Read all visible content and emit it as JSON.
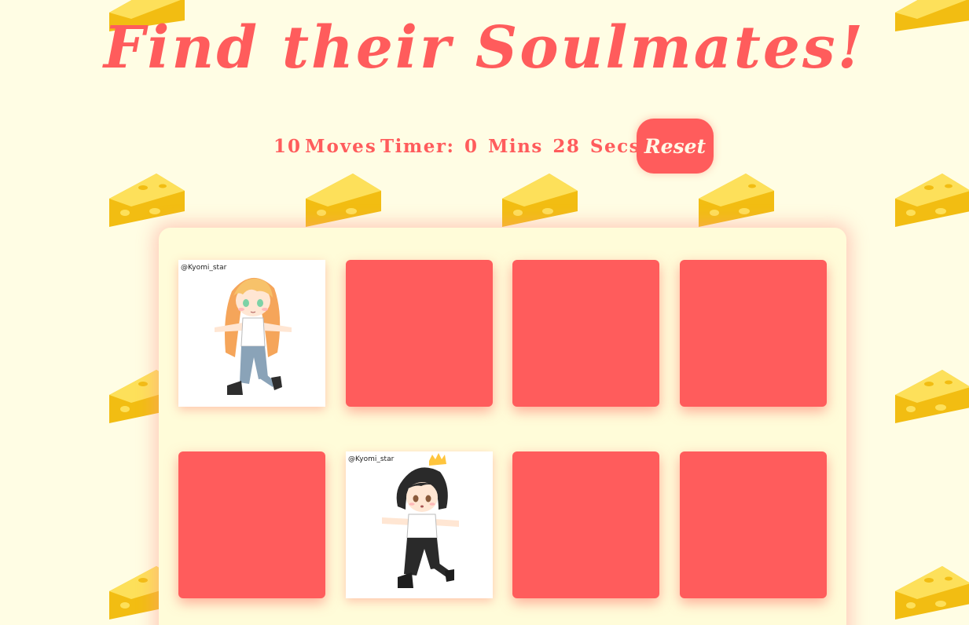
{
  "title": "Find their Soulmates!",
  "score_panel": {
    "moves_count": "10",
    "moves_label": "Moves",
    "timer_text": "Timer: 0 Mins 28 Secs",
    "reset_label": "Reset"
  },
  "colors": {
    "accent": "#ff5c5c",
    "background": "#fffde4",
    "deck": "#fffcd9",
    "cheese": "#f7c818"
  },
  "deck": {
    "cards": [
      {
        "state": "open",
        "character": "blonde-girl",
        "watermark": "@Kyomi_star"
      },
      {
        "state": "closed"
      },
      {
        "state": "closed"
      },
      {
        "state": "closed"
      },
      {
        "state": "closed"
      },
      {
        "state": "open",
        "character": "dark-haired-boy-crown",
        "watermark": "@Kyomi_star"
      },
      {
        "state": "closed"
      },
      {
        "state": "closed"
      }
    ]
  },
  "background_icon": "cheese-icon"
}
